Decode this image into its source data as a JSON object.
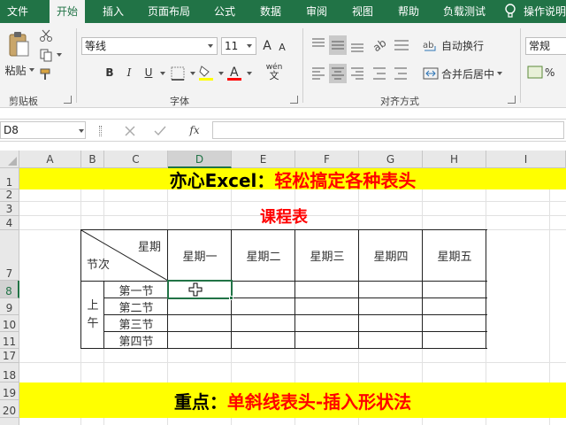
{
  "ribbon": {
    "tabs": [
      "文件",
      "开始",
      "插入",
      "页面布局",
      "公式",
      "数据",
      "审阅",
      "视图",
      "帮助",
      "负载测试",
      "操作说明"
    ],
    "active_tab": "开始",
    "clipboard": {
      "paste_label": "粘贴",
      "group_label": "剪贴板"
    },
    "font": {
      "name": "等线",
      "size": "11",
      "bold": "B",
      "italic": "I",
      "underline": "U",
      "big_a": "A",
      "small_a": "A",
      "phonetic": "wén",
      "group_label": "字体"
    },
    "alignment": {
      "wrap_text": "自动换行",
      "merge_center": "合并后居中",
      "group_label": "对齐方式"
    },
    "number": {
      "format": "常规"
    }
  },
  "formula_bar": {
    "name_box": "D8",
    "fx": "fx",
    "formula": ""
  },
  "grid": {
    "columns": [
      "A",
      "B",
      "C",
      "D",
      "E",
      "F",
      "G",
      "H",
      "I"
    ],
    "rows": [
      "1",
      "2",
      "3",
      "4",
      "7",
      "8",
      "9",
      "10",
      "11",
      "17",
      "18",
      "19",
      "20"
    ],
    "selected_col": "D",
    "selected_row": "8"
  },
  "sheet": {
    "banner_top": {
      "black": "亦心Excel：",
      "red": "轻松搞定各种表头"
    },
    "table_title": "课程表",
    "header_week": "星期",
    "header_section": "节次",
    "days": [
      "星期一",
      "星期二",
      "星期三",
      "星期四",
      "星期五"
    ],
    "period_top": "上",
    "period_bottom": "午",
    "lessons": [
      "第一节",
      "第二节",
      "第三节",
      "第四节"
    ],
    "banner_bottom": {
      "black": "重点：",
      "red": "单斜线表头-插入形状法"
    }
  },
  "colors": {
    "excel_green": "#217346",
    "banner_yellow": "#ffff00",
    "title_red": "#ff0000"
  }
}
